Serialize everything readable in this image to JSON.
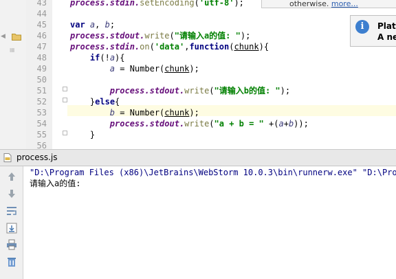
{
  "editor": {
    "line_numbers": [
      "43",
      "44",
      "45",
      "46",
      "47",
      "48",
      "49",
      "50",
      "51",
      "52",
      "53",
      "54",
      "55",
      "56"
    ],
    "lines": {
      "l43": {
        "obj": "process",
        "rest1": ".stdin.",
        "fn": "setEncoding",
        "rest2": "(",
        "str": "'utf-8'",
        "rest3": ");"
      },
      "l45": {
        "kw": "var",
        "var1": "a",
        "sep": ", ",
        "var2": "b",
        "end": ";"
      },
      "l46": {
        "obj": "process",
        "mid": ".stdout.",
        "fn": "write",
        "open": "(",
        "str": "\"请输入a的值: \"",
        "close": ");"
      },
      "l47": {
        "obj": "process",
        "mid": ".stdin.",
        "fn": "on",
        "open": "(",
        "str": "'data'",
        "comma": ",",
        "kw": "function",
        "paren": "(",
        "param": "chunk",
        "end": "){"
      },
      "l48": {
        "indent": "    ",
        "kw": "if",
        "cond_open": "(!",
        "var": "a",
        "cond_close": "){"
      },
      "l49": {
        "indent": "        ",
        "var": "a",
        "assign": " = Number(",
        "param": "chunk",
        "end": ");"
      },
      "l51": {
        "indent": "        ",
        "obj": "process",
        "mid": ".stdout.",
        "fn": "write",
        "open": "(",
        "str": "\"请输入b的值: \"",
        "close": ");"
      },
      "l52": {
        "indent": "    ",
        "brace": "}",
        "kw": "else",
        "end": "{"
      },
      "l53": {
        "indent": "        ",
        "var": "b",
        "assign": " = Number(",
        "param": "chunk",
        "end": ");"
      },
      "l54": {
        "indent": "        ",
        "obj": "process",
        "mid": ".stdout.",
        "fn": "write",
        "open": "(",
        "str": "\"a + b = \"",
        "plus": " +(",
        "var1": "a",
        "op": "+",
        "var2": "b",
        "end": "));"
      },
      "l55": {
        "indent": "    ",
        "end": "}"
      }
    }
  },
  "notifications": {
    "top": {
      "text": "otherwise. ",
      "link": "more..."
    },
    "info": {
      "title": "Plat",
      "text": "A ne"
    }
  },
  "run_panel": {
    "tab_label": "process.js",
    "console_lines": [
      "\"D:\\Program Files (x86)\\JetBrains\\WebStorm 10.0.3\\bin\\runnerw.exe\" \"D:\\Progr",
      "请输入a的值:"
    ]
  },
  "colors": {
    "keyword": "#000080",
    "object": "#660e7a",
    "string": "#008000",
    "current_line": "#fefce2",
    "info_icon": "#3d7fcf"
  },
  "icons": [
    "folder-icon",
    "info-icon",
    "js-file-icon",
    "arrow-up-icon",
    "arrow-down-icon",
    "soft-wrap-icon",
    "scroll-to-end-icon",
    "print-icon",
    "trash-icon"
  ]
}
